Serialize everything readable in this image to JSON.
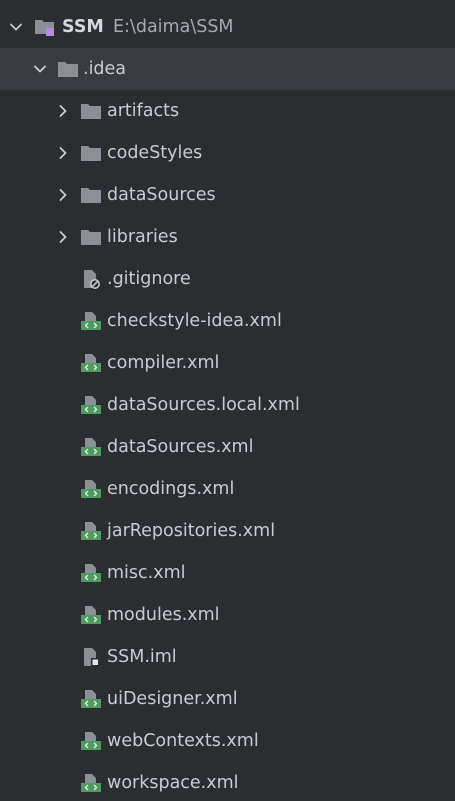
{
  "project": {
    "name": "SSM",
    "path": "E:\\daima\\SSM",
    "icon": "project-folder-icon",
    "expanded": true
  },
  "idea_folder": {
    "name": ".idea",
    "icon": "folder-icon",
    "expanded": true,
    "selected": true
  },
  "folders": [
    {
      "name": "artifacts",
      "icon": "folder-icon",
      "expanded": false
    },
    {
      "name": "codeStyles",
      "icon": "folder-icon",
      "expanded": false
    },
    {
      "name": "dataSources",
      "icon": "folder-icon",
      "expanded": false
    },
    {
      "name": "libraries",
      "icon": "folder-icon",
      "expanded": false
    }
  ],
  "files": [
    {
      "name": ".gitignore",
      "icon": "ignored-file-icon"
    },
    {
      "name": "checkstyle-idea.xml",
      "icon": "xml-file-icon"
    },
    {
      "name": "compiler.xml",
      "icon": "xml-file-icon"
    },
    {
      "name": "dataSources.local.xml",
      "icon": "xml-file-icon"
    },
    {
      "name": "dataSources.xml",
      "icon": "xml-file-icon"
    },
    {
      "name": "encodings.xml",
      "icon": "xml-file-icon"
    },
    {
      "name": "jarRepositories.xml",
      "icon": "xml-file-icon"
    },
    {
      "name": "misc.xml",
      "icon": "xml-file-icon"
    },
    {
      "name": "modules.xml",
      "icon": "xml-file-icon"
    },
    {
      "name": "SSM.iml",
      "icon": "module-file-icon"
    },
    {
      "name": "uiDesigner.xml",
      "icon": "xml-file-icon"
    },
    {
      "name": "webContexts.xml",
      "icon": "xml-file-icon"
    },
    {
      "name": "workspace.xml",
      "icon": "xml-file-icon"
    }
  ],
  "colors": {
    "background": "#2b2d30",
    "selection": "#393b40",
    "text": "#c9ccd1",
    "folder": "#8c9096",
    "xml_green": "#4f9a62",
    "module_purple": "#b48ae6"
  }
}
